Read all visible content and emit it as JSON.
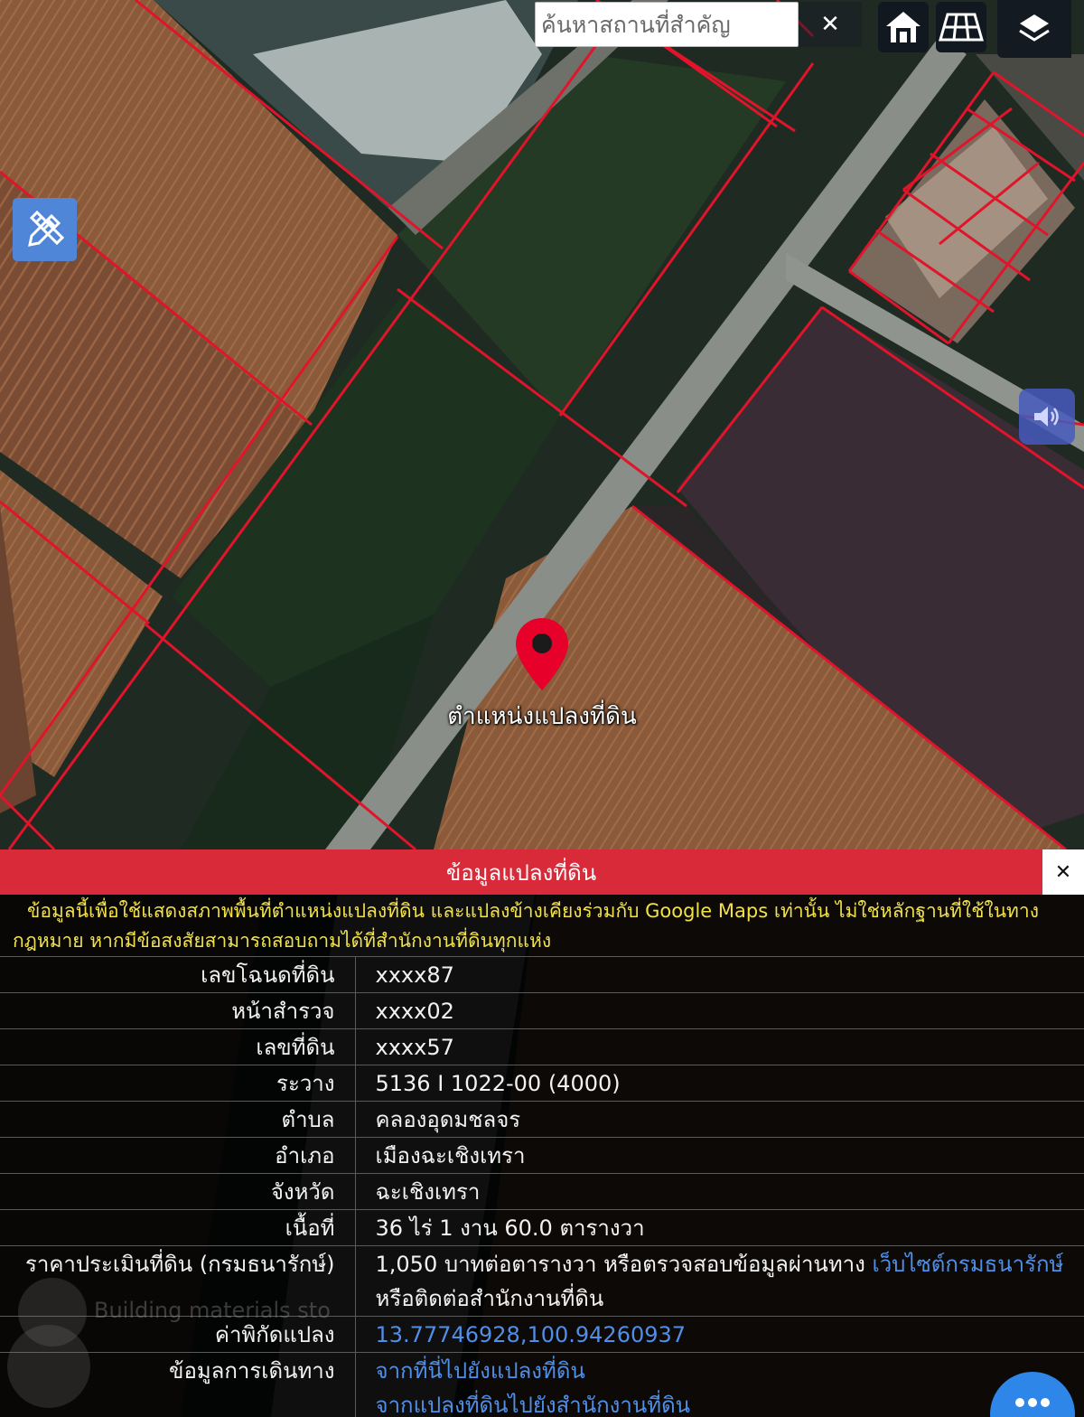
{
  "map": {
    "search_placeholder": "ค้นหาสถานที่สำคัญ",
    "clear_symbol": "✕",
    "marker_label": "ตำแหน่งแปลงที่ดิน",
    "parcel_line_color": "#e0142a"
  },
  "panel": {
    "title": "ข้อมูลแปลงที่ดิน",
    "close_symbol": "✕",
    "disclaimer": "ข้อมูลนี้เพื่อใช้แสดงสภาพพื้นที่ตำแหน่งแปลงที่ดิน และแปลงข้างเคียงร่วมกับ Google Maps เท่านั้น ไม่ใช่หลักฐานที่ใช้ในทางกฎหมาย หากมีข้อสงสัยสามารถสอบถามได้ที่สำนักงานที่ดินทุกแห่ง",
    "rows": [
      {
        "label": "เลขโฉนดที่ดิน",
        "value": "xxxx87"
      },
      {
        "label": "หน้าสำรวจ",
        "value": "xxxx02"
      },
      {
        "label": "เลขที่ดิน",
        "value": "xxxx57"
      },
      {
        "label": "ระวาง",
        "value": "5136 I 1022-00 (4000)"
      },
      {
        "label": "ตำบล",
        "value": "คลองอุดมชลจร"
      },
      {
        "label": "อำเภอ",
        "value": "เมืองฉะเชิงเทรา"
      },
      {
        "label": "จังหวัด",
        "value": "ฉะเชิงเทรา"
      },
      {
        "label": "เนื้อที่",
        "value": "36 ไร่ 1 งาน 60.0 ตารางวา"
      }
    ],
    "price": {
      "label": "ราคาประเมินที่ดิน (กรมธนารักษ์)",
      "text": "1,050 บาทต่อตารางวา หรือตรวจสอบข้อมูลผ่านทาง ",
      "link": "เว็บไซต์กรมธนารักษ์",
      "text2": "หรือติดต่อสำนักงานที่ดิน"
    },
    "coords": {
      "label": "ค่าพิกัดแปลง",
      "value": "13.77746928,100.94260937"
    },
    "travel": {
      "label": "ข้อมูลการเดินทาง",
      "link1": "จากที่นี่ไปยังแปลงที่ดิน",
      "link2": "จากแปลงที่ดินไปยังสำนักงานที่ดิน"
    },
    "ghost_text": "Building materials sto"
  },
  "colors": {
    "header": "#d92a39",
    "disclaimer": "#f2e24a",
    "link": "#4f8fe8",
    "fab": "#2d86e8"
  }
}
